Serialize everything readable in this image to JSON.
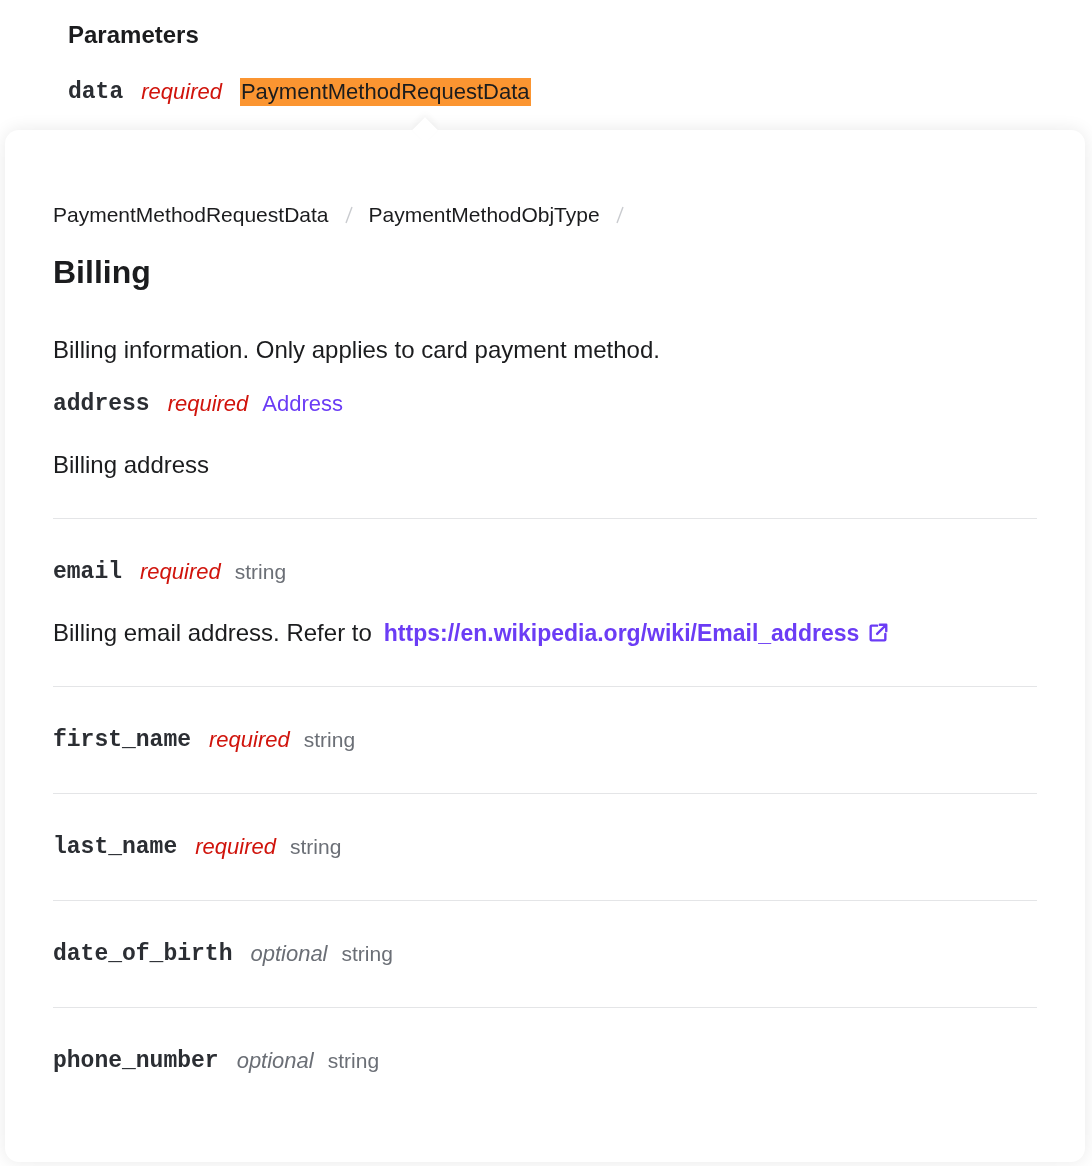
{
  "section": {
    "title": "Parameters"
  },
  "parameter": {
    "name": "data",
    "requirement": "required",
    "type": "PaymentMethodRequestData",
    "highlighted": true
  },
  "popover": {
    "breadcrumb": [
      {
        "label": "PaymentMethodRequestData"
      },
      {
        "label": "PaymentMethodObjType"
      }
    ],
    "title": "Billing",
    "description": "Billing information. Only applies to card payment method.",
    "fields": [
      {
        "name": "address",
        "requirement": "required",
        "type": "Address",
        "kind": "link",
        "description": "Billing address"
      },
      {
        "name": "email",
        "requirement": "required",
        "type": "string",
        "kind": "plain",
        "description": "Billing email address. Refer to",
        "link": "https://en.wikipedia.org/wiki/Email_address"
      },
      {
        "name": "first_name",
        "requirement": "required",
        "type": "string",
        "kind": "plain"
      },
      {
        "name": "last_name",
        "requirement": "required",
        "type": "string",
        "kind": "plain"
      },
      {
        "name": "date_of_birth",
        "requirement": "optional",
        "type": "string",
        "kind": "plain"
      },
      {
        "name": "phone_number",
        "requirement": "optional",
        "type": "string",
        "kind": "plain"
      }
    ]
  }
}
